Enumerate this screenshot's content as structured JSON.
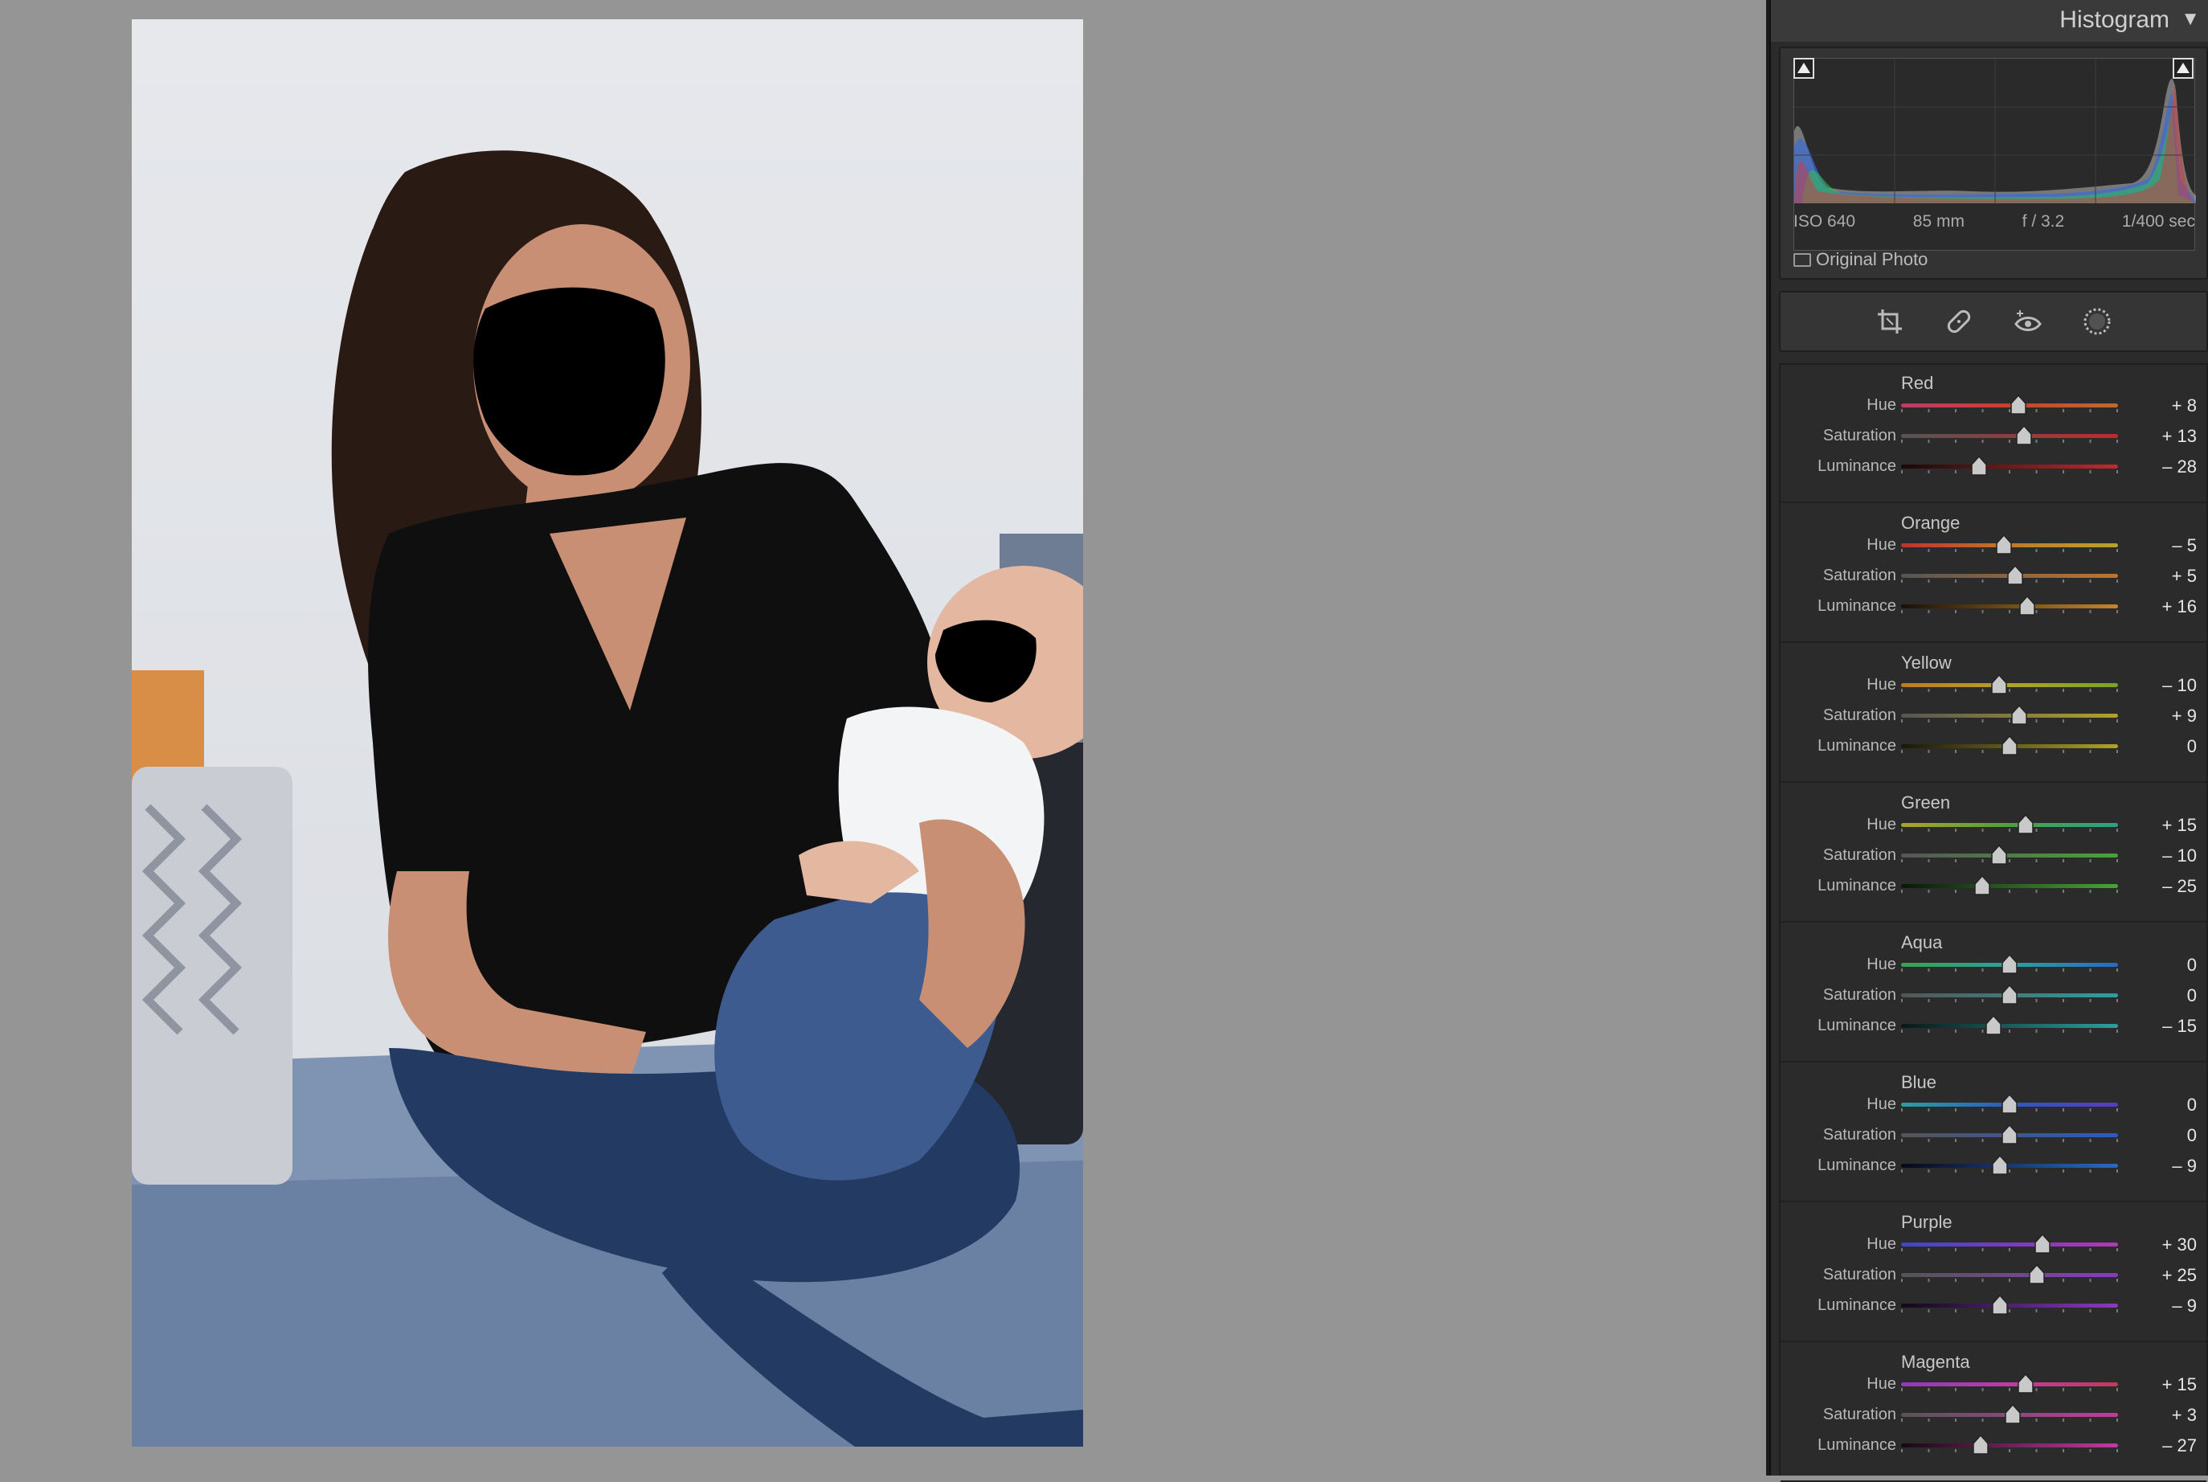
{
  "histogram": {
    "title": "Histogram",
    "iso": "ISO 640",
    "focal_length": "85 mm",
    "aperture": "f / 3.2",
    "shutter": "1/400 sec",
    "original_photo_label": "Original Photo"
  },
  "tools": [
    {
      "name": "crop-icon"
    },
    {
      "name": "heal-icon"
    },
    {
      "name": "red-eye-icon"
    },
    {
      "name": "masking-icon"
    }
  ],
  "hsl": [
    {
      "title": "Red",
      "gradients": [
        "linear-gradient(90deg,#c23a6a,#c8402e,#c06a2a)",
        "linear-gradient(90deg,#555,#c22a2a)",
        "linear-gradient(90deg,#1a0808,#c22a2a)"
      ],
      "rows": [
        {
          "label": "Hue",
          "value": 8,
          "display": "+ 8"
        },
        {
          "label": "Saturation",
          "value": 13,
          "display": "+ 13"
        },
        {
          "label": "Luminance",
          "value": -28,
          "display": "– 28"
        }
      ]
    },
    {
      "title": "Orange",
      "gradients": [
        "linear-gradient(90deg,#c0302e,#c07a2a,#b8a22a)",
        "linear-gradient(90deg,#555,#c2742a)",
        "linear-gradient(90deg,#1a1008,#c2882a)"
      ],
      "rows": [
        {
          "label": "Hue",
          "value": -5,
          "display": "– 5"
        },
        {
          "label": "Saturation",
          "value": 5,
          "display": "+ 5"
        },
        {
          "label": "Luminance",
          "value": 16,
          "display": "+ 16"
        }
      ]
    },
    {
      "title": "Yellow",
      "gradients": [
        "linear-gradient(90deg,#c07a2a,#b0a22a,#7aa22a)",
        "linear-gradient(90deg,#555,#b0a22a)",
        "linear-gradient(90deg,#181808,#b0a22a)"
      ],
      "rows": [
        {
          "label": "Hue",
          "value": -10,
          "display": "– 10"
        },
        {
          "label": "Saturation",
          "value": 9,
          "display": "+ 9"
        },
        {
          "label": "Luminance",
          "value": 0,
          "display": "0"
        }
      ]
    },
    {
      "title": "Green",
      "gradients": [
        "linear-gradient(90deg,#b0a22a,#4aa23a,#2aa28a)",
        "linear-gradient(90deg,#555,#4aa23a)",
        "linear-gradient(90deg,#081808,#4aa23a)"
      ],
      "rows": [
        {
          "label": "Hue",
          "value": 15,
          "display": "+ 15"
        },
        {
          "label": "Saturation",
          "value": -10,
          "display": "– 10"
        },
        {
          "label": "Luminance",
          "value": -25,
          "display": "– 25"
        }
      ]
    },
    {
      "title": "Aqua",
      "gradients": [
        "linear-gradient(90deg,#3aa24a,#2aa0a0,#2a6ac0)",
        "linear-gradient(90deg,#555,#2aa0a0)",
        "linear-gradient(90deg,#081818,#2aa0a0)"
      ],
      "rows": [
        {
          "label": "Hue",
          "value": 0,
          "display": "0"
        },
        {
          "label": "Saturation",
          "value": 0,
          "display": "0"
        },
        {
          "label": "Luminance",
          "value": -15,
          "display": "– 15"
        }
      ]
    },
    {
      "title": "Blue",
      "gradients": [
        "linear-gradient(90deg,#2aa0a0,#2a5ac2,#5a3ac2)",
        "linear-gradient(90deg,#555,#2a5ac2)",
        "linear-gradient(90deg,#080818,#2a6ac2)"
      ],
      "rows": [
        {
          "label": "Hue",
          "value": 0,
          "display": "0"
        },
        {
          "label": "Saturation",
          "value": 0,
          "display": "0"
        },
        {
          "label": "Luminance",
          "value": -9,
          "display": "– 9"
        }
      ]
    },
    {
      "title": "Purple",
      "gradients": [
        "linear-gradient(90deg,#3a4ac2,#7a3ac2,#b03ab0)",
        "linear-gradient(90deg,#555,#8a3ac2)",
        "linear-gradient(90deg,#100818,#8a3ac2)"
      ],
      "rows": [
        {
          "label": "Hue",
          "value": 30,
          "display": "+ 30"
        },
        {
          "label": "Saturation",
          "value": 25,
          "display": "+ 25"
        },
        {
          "label": "Luminance",
          "value": -9,
          "display": "– 9"
        }
      ]
    },
    {
      "title": "Magenta",
      "gradients": [
        "linear-gradient(90deg,#8a3ac2,#c23aa0,#c23a5a)",
        "linear-gradient(90deg,#555,#c23aa0)",
        "linear-gradient(90deg,#180812,#c23aa0)"
      ],
      "rows": [
        {
          "label": "Hue",
          "value": 15,
          "display": "+ 15"
        },
        {
          "label": "Saturation",
          "value": 3,
          "display": "+ 3"
        },
        {
          "label": "Luminance",
          "value": -27,
          "display": "– 27"
        }
      ]
    }
  ]
}
